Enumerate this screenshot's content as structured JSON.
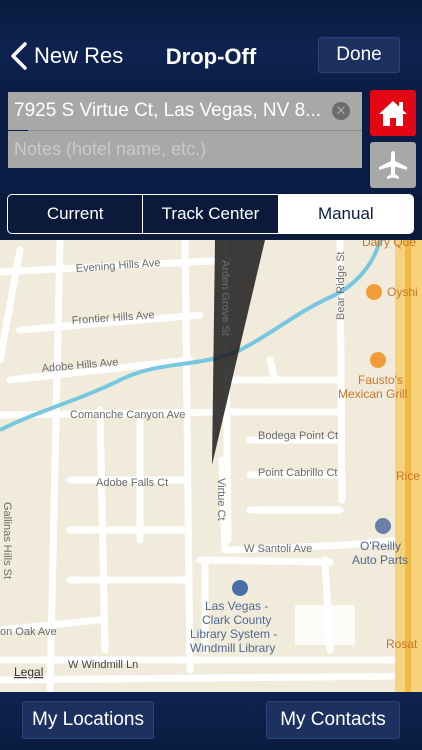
{
  "nav": {
    "back_label": "New Res",
    "title": "Drop-Off",
    "done_label": "Done"
  },
  "address": {
    "value": "7925 S Virtue Ct, Las Vegas, NV 8...",
    "notes_placeholder": "Notes (hotel name, etc.)"
  },
  "icons": {
    "home": "home-icon",
    "airport": "airplane-icon"
  },
  "segments": [
    {
      "label": "Current"
    },
    {
      "label": "Track Center"
    },
    {
      "label": "Manual"
    }
  ],
  "map_labels": {
    "evening_hills": "Evening Hills Ave",
    "frontier_hills": "Frontier Hills Ave",
    "adobe_hills": "Adobe Hills Ave",
    "comanche": "Comanche Canyon Ave",
    "adobe_falls": "Adobe Falls Ct",
    "bodega": "Bodega Point Ct",
    "cabrillo": "Point Cabrillo Ct",
    "virtue": "Virtue Ct",
    "arden": "Arden Grove St",
    "bear_ridge": "Bear Ridge St",
    "santoli": "W Santoli Ave",
    "windmill": "W Windmill Ln",
    "oak": "on Oak Ave",
    "hills_st": "Gallinas Hills St",
    "dairy": "Dairy Que",
    "oyshi": "Oyshi",
    "faustos": "Fausto's",
    "faustos2": "Mexican Grill",
    "oreilly": "O'Reilly",
    "oreilly2": "Auto Parts",
    "library1": "Las Vegas -",
    "library2": "Clark County",
    "library3": "Library System -",
    "library4": "Windmill Library",
    "rice": "Rice",
    "rosat": "Rosat",
    "legal": "Legal"
  },
  "colors": {
    "accent_red": "#e30613",
    "map_bg": "#f1ebdb",
    "water": "#76c7e0"
  },
  "bottom": {
    "locations_label": "My Locations",
    "contacts_label": "My Contacts"
  }
}
